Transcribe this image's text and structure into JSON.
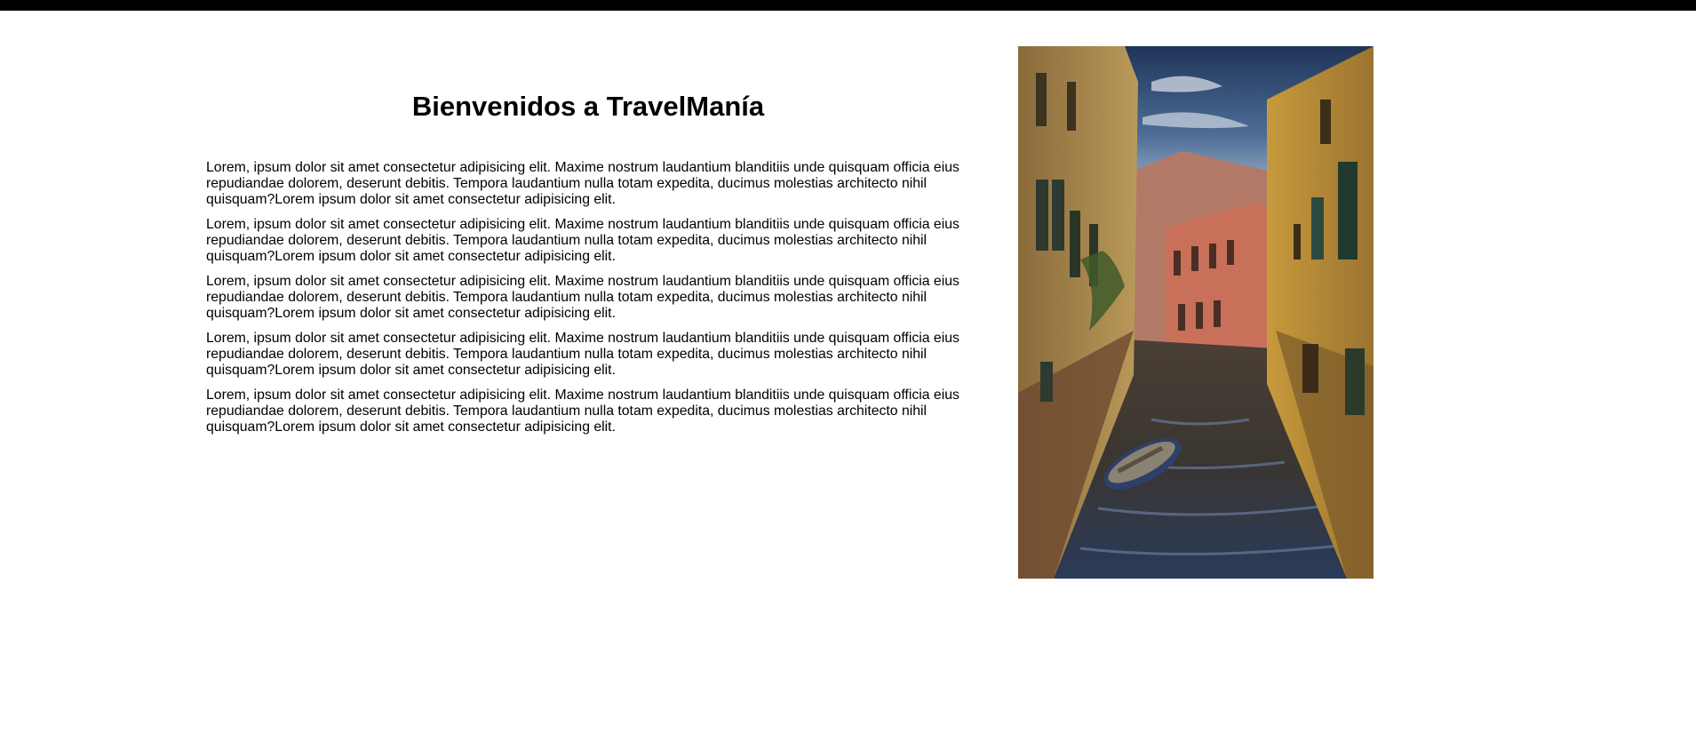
{
  "page": {
    "title": "Bienvenidos a TravelManía"
  },
  "paragraphs": [
    "Lorem, ipsum dolor sit amet consectetur adipisicing elit. Maxime nostrum laudantium blanditiis unde quisquam officia eius repudiandae dolorem, deserunt debitis. Tempora laudantium nulla totam expedita, ducimus molestias architecto nihil quisquam?Lorem ipsum dolor sit amet consectetur adipisicing elit.",
    "Lorem, ipsum dolor sit amet consectetur adipisicing elit. Maxime nostrum laudantium blanditiis unde quisquam officia eius repudiandae dolorem, deserunt debitis. Tempora laudantium nulla totam expedita, ducimus molestias architecto nihil quisquam?Lorem ipsum dolor sit amet consectetur adipisicing elit.",
    "Lorem, ipsum dolor sit amet consectetur adipisicing elit. Maxime nostrum laudantium blanditiis unde quisquam officia eius repudiandae dolorem, deserunt debitis. Tempora laudantium nulla totam expedita, ducimus molestias architecto nihil quisquam?Lorem ipsum dolor sit amet consectetur adipisicing elit.",
    "Lorem, ipsum dolor sit amet consectetur adipisicing elit. Maxime nostrum laudantium blanditiis unde quisquam officia eius repudiandae dolorem, deserunt debitis. Tempora laudantium nulla totam expedita, ducimus molestias architecto nihil quisquam?Lorem ipsum dolor sit amet consectetur adipisicing elit.",
    "Lorem, ipsum dolor sit amet consectetur adipisicing elit. Maxime nostrum laudantium blanditiis unde quisquam officia eius repudiandae dolorem, deserunt debitis. Tempora laudantium nulla totam expedita, ducimus molestias architecto nihil quisquam?Lorem ipsum dolor sit amet consectetur adipisicing elit."
  ],
  "colors": {
    "top_bar": "#000000",
    "background": "#ffffff",
    "text": "#000000"
  }
}
